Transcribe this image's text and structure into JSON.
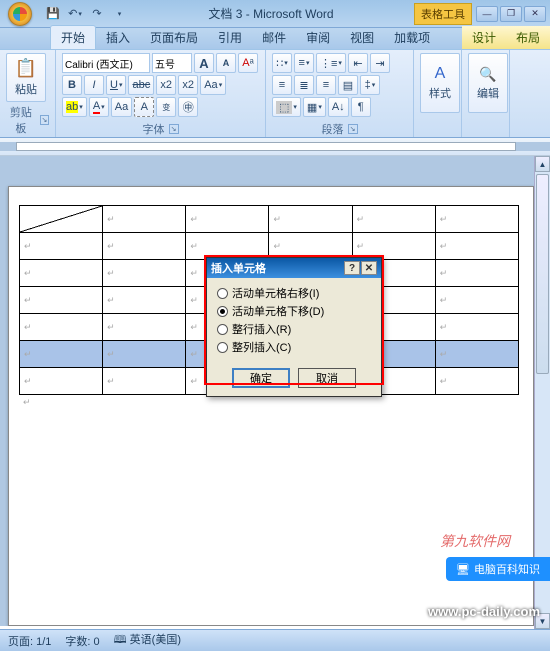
{
  "titlebar": {
    "doc_title": "文档 3 - Microsoft Word",
    "context_tool": "表格工具",
    "qat_save": "save-icon",
    "qat_undo": "undo-icon",
    "qat_redo": "redo-icon"
  },
  "tabs": {
    "home": "开始",
    "insert": "插入",
    "page_layout": "页面布局",
    "references": "引用",
    "mailings": "邮件",
    "review": "审阅",
    "view": "视图",
    "addins": "加载项",
    "design": "设计",
    "layout": "布局"
  },
  "ribbon": {
    "clipboard": {
      "label": "剪贴板",
      "paste": "粘贴"
    },
    "font": {
      "label": "字体",
      "family": "Calibri (西文正)",
      "size": "五号",
      "bold": "B",
      "italic": "I",
      "underline": "U",
      "strike": "abc",
      "sub": "x₂",
      "sup": "x²",
      "grow": "A",
      "shrink": "A",
      "clear": "Aᵃ",
      "highlight": "aby",
      "fontcolor": "A",
      "charshade": "Aa",
      "charborder": "A",
      "phonetic": "A",
      "enclose": "字"
    },
    "paragraph": {
      "label": "段落"
    },
    "styles": {
      "label": "样式"
    },
    "editing": {
      "label": "编辑"
    }
  },
  "dialog": {
    "title": "插入单元格",
    "opt_shift_right": "活动单元格右移(I)",
    "opt_shift_down": "活动单元格下移(D)",
    "opt_insert_row": "整行插入(R)",
    "opt_insert_col": "整列插入(C)",
    "ok": "确定",
    "cancel": "取消",
    "selected": "opt_shift_down"
  },
  "statusbar": {
    "page": "页面: 1/1",
    "words": "字数: 0",
    "language": "英语(美国)"
  },
  "watermark": {
    "url": "www.pc-daily.com",
    "banner": "电脑百科知识",
    "text2": "第九软件网"
  },
  "table": {
    "rows": 7,
    "cols": 6,
    "cell_mark": "↵",
    "diagonal_cell": [
      0,
      0
    ],
    "selected_row": 5
  }
}
